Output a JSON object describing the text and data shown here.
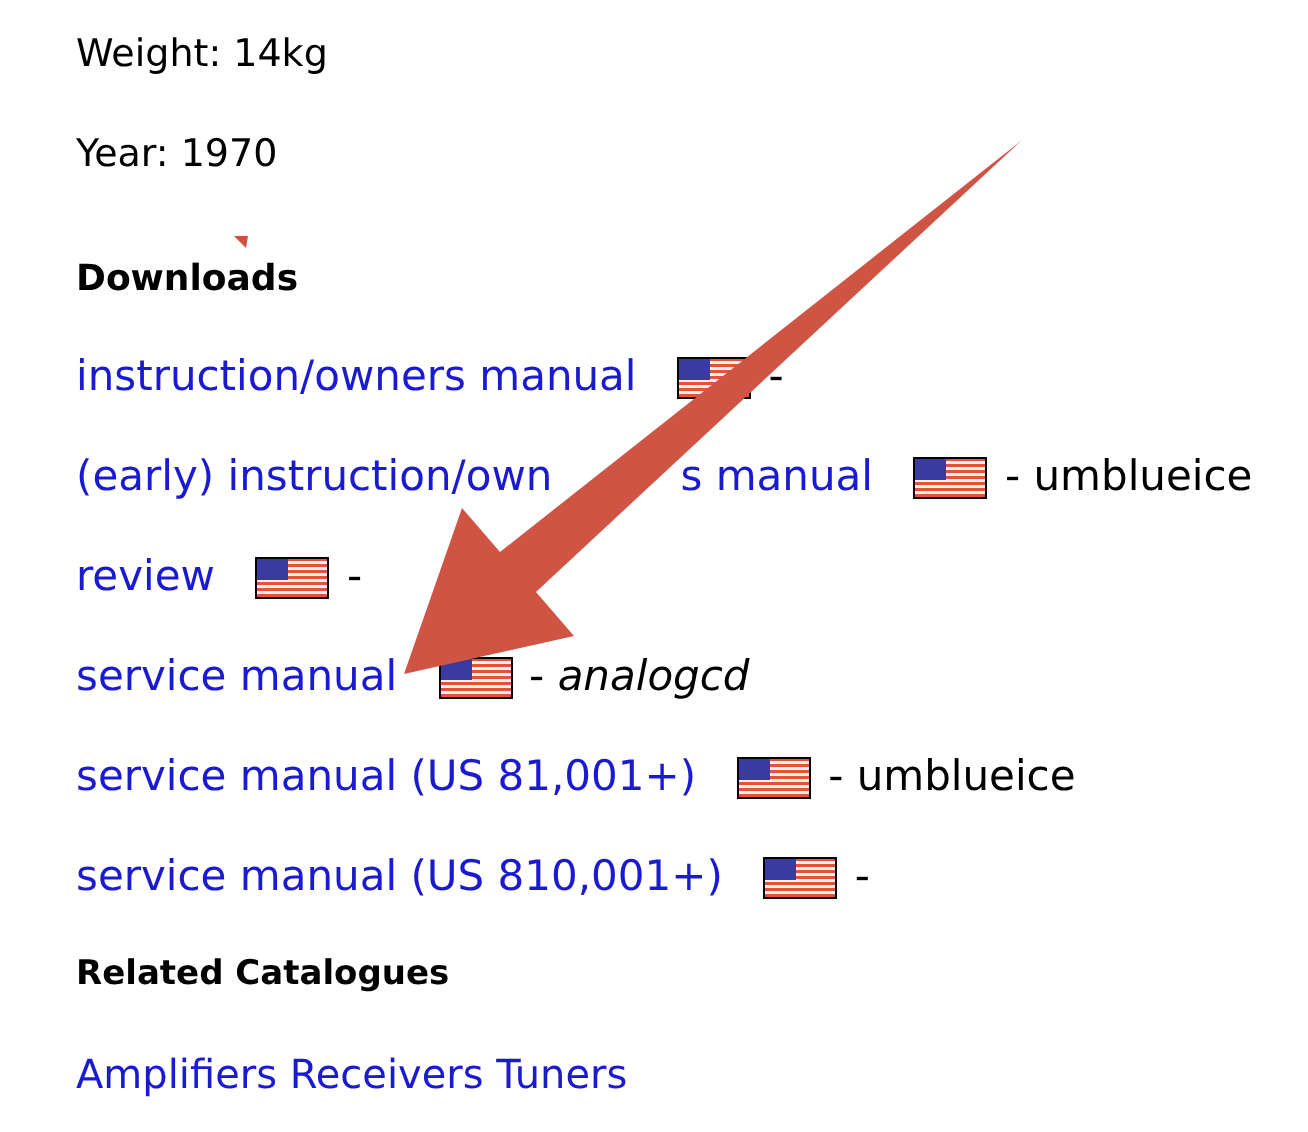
{
  "details": [
    "Weight: 14kg",
    "Year: 1970"
  ],
  "downloads": {
    "heading": "Downloads",
    "items": [
      {
        "link_parts": [
          "instruction/owners manual"
        ],
        "suffix": "-"
      },
      {
        "link_parts": [
          "(early) instruction/own",
          "s manual"
        ],
        "suffix": "- umblueice"
      },
      {
        "link_parts": [
          "review"
        ],
        "suffix": "-"
      },
      {
        "link_parts": [
          "service manual"
        ],
        "suffix": "- *analogcd*"
      },
      {
        "link_parts": [
          "service manual (US 81,001+)"
        ],
        "suffix": "- umblueice"
      },
      {
        "link_parts": [
          "service manual (US 810,001+)"
        ],
        "suffix": "-"
      }
    ]
  },
  "related": {
    "heading": "Related Catalogues",
    "links": [
      "Amplifiers Receivers Tuners"
    ]
  }
}
